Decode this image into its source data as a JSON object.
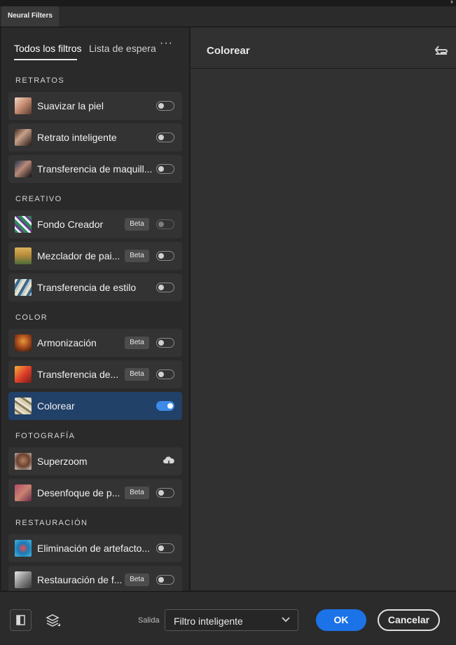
{
  "window": {
    "panel_title": "Neural Filters",
    "collapse_icon": "double-chevron-right-icon"
  },
  "tabs": [
    {
      "label": "Todos los filtros",
      "active": true
    },
    {
      "label": "Lista de espera",
      "active": false
    }
  ],
  "more_icon": "···",
  "sections": [
    {
      "title": "RETRATOS",
      "items": [
        {
          "label": "Suavizar la piel",
          "beta": "",
          "state": "off",
          "thumb": "portrait-skin"
        },
        {
          "label": "Retrato inteligente",
          "beta": "",
          "state": "off",
          "thumb": "portrait-smart"
        },
        {
          "label": "Transferencia de maquill...",
          "beta": "",
          "state": "off",
          "thumb": "portrait-makeup"
        }
      ]
    },
    {
      "title": "CREATIVO",
      "items": [
        {
          "label": "Fondo Creador",
          "beta": "Beta",
          "state": "dim",
          "thumb": "leaf-pattern"
        },
        {
          "label": "Mezclador de pai...",
          "beta": "Beta",
          "state": "off",
          "thumb": "landscape"
        },
        {
          "label": "Transferencia de estilo",
          "beta": "",
          "state": "off",
          "thumb": "style-art"
        }
      ]
    },
    {
      "title": "COLOR",
      "items": [
        {
          "label": "Armonización",
          "beta": "Beta",
          "state": "off",
          "thumb": "harmony"
        },
        {
          "label": "Transferencia de...",
          "beta": "Beta",
          "state": "off",
          "thumb": "color-transfer"
        },
        {
          "label": "Colorear",
          "beta": "",
          "state": "on",
          "thumb": "colorize",
          "selected": true
        }
      ]
    },
    {
      "title": "FOTOGRAFÍA",
      "items": [
        {
          "label": "Superzoom",
          "beta": "",
          "state": "cloud",
          "thumb": "superzoom"
        },
        {
          "label": "Desenfoque de p...",
          "beta": "Beta",
          "state": "off",
          "thumb": "blur"
        }
      ]
    },
    {
      "title": "RESTAURACIÓN",
      "items": [
        {
          "label": "Eliminación de artefacto...",
          "beta": "",
          "state": "off",
          "thumb": "artifacts"
        },
        {
          "label": "Restauración de f...",
          "beta": "Beta",
          "state": "off",
          "thumb": "photo-restore"
        }
      ]
    }
  ],
  "main": {
    "title": "Colorear",
    "reset_icon": "reset-icon"
  },
  "footer": {
    "output_label": "Salida",
    "output_value": "Filtro inteligente",
    "ok_label": "OK",
    "cancel_label": "Cancelar"
  },
  "colors": {
    "accent": "#1c73e8",
    "selected_row": "#214169",
    "toggle_on": "#3d8ae8"
  }
}
